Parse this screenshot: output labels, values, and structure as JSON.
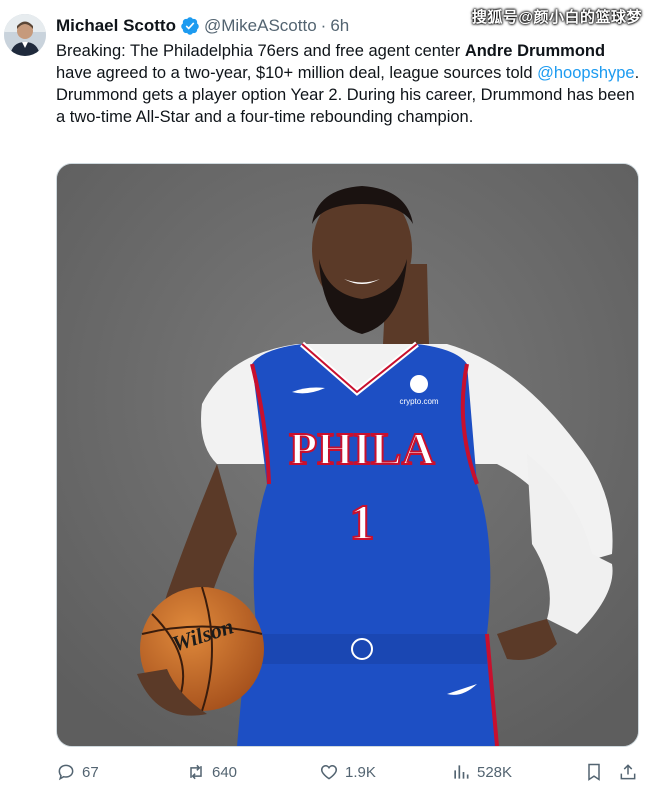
{
  "tweet": {
    "author_name": "Michael Scotto",
    "author_handle": "@MikeAScotto",
    "separator": "·",
    "time": "6h",
    "text_1": "Breaking: The Philadelphia 76ers and free agent center ",
    "text_bold": "Andre Drummond",
    "text_2": " have agreed to a two-year, $10+ million deal, league sources told ",
    "mention": "@hoopshype",
    "text_3": ". Drummond gets a player option Year 2. During his career, Drummond has been a two-time All-Star and a four-time rebounding champion."
  },
  "watermark": "搜狐号@颜小白的篮球梦",
  "media": {
    "jersey_wordmark": "PHILA",
    "jersey_number": "1",
    "sponsor_patch": "crypto.com",
    "ball_brand": "Wilson"
  },
  "actions": {
    "replies": "67",
    "reposts": "640",
    "likes": "1.9K",
    "views": "528K"
  },
  "colors": {
    "accent": "#1d9bf0",
    "muted": "#536471",
    "jersey_blue": "#1d4fc4",
    "jersey_red": "#c8102e",
    "background": "#6e6e6e"
  }
}
